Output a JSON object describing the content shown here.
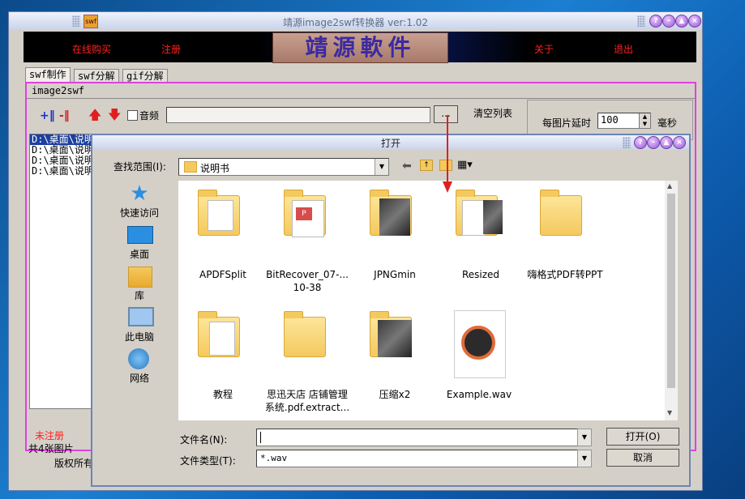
{
  "app": {
    "title": "靖源image2swf转换器 ver:1.02",
    "banner": {
      "buy": "在线购买",
      "register": "注册",
      "logo": "靖源軟件",
      "about": "关于",
      "exit": "退出"
    },
    "tabs": [
      "swf制作",
      "swf分解",
      "gif分解"
    ],
    "group_title": "image2swf",
    "audio_label": "音频",
    "browse_label": "...",
    "clear_list": "清空列表",
    "delay_label": "每图片延时",
    "delay_value": "100",
    "delay_unit": "毫秒",
    "files": [
      "D:\\桌面\\说明",
      "D:\\桌面\\说明",
      "D:\\桌面\\说明",
      "D:\\桌面\\说明"
    ],
    "status_unregistered": "未注册",
    "status_count": "共4张图片",
    "footer": "版权所有"
  },
  "dialog": {
    "title": "打开",
    "look_in_label": "查找范围(I):",
    "look_in_value": "说明书",
    "places": [
      "快速访问",
      "桌面",
      "库",
      "此电脑",
      "网络"
    ],
    "items_row1": [
      "APDFSplit",
      "BitRecover_07-...\n10-38",
      "JPNGmin",
      "Resized",
      "嗨格式PDF转PPT"
    ],
    "items_row2": [
      "教程",
      "思迅天店 店铺管理\n系统.pdf.extract...",
      "压缩x2",
      "Example.wav"
    ],
    "filename_label": "文件名(N):",
    "filename_value": "",
    "filetype_label": "文件类型(T):",
    "filetype_value": "*.wav",
    "open_button": "打开(O)",
    "cancel_button": "取消"
  },
  "colors": {
    "accent_red": "#ff2020",
    "highlight": "#e040e0",
    "title_bar": "#c8d3ea"
  }
}
